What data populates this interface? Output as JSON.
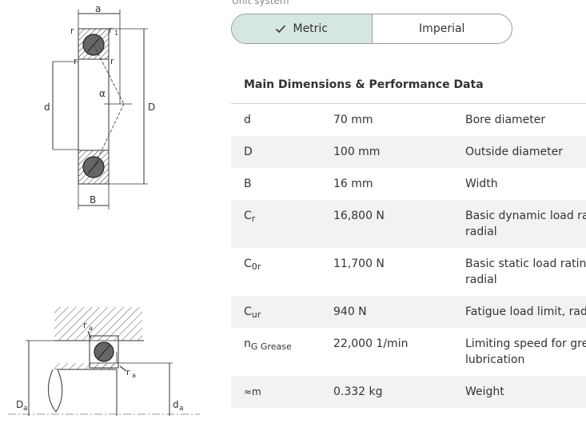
{
  "unit_system": {
    "label": "Unit system",
    "options": [
      {
        "label": "Metric",
        "selected": true
      },
      {
        "label": "Imperial",
        "selected": false
      }
    ]
  },
  "section": {
    "title": "Main Dimensions & Performance Data"
  },
  "drawing_top": {
    "labels": {
      "a": "a",
      "r": "r",
      "r1": "r",
      "r1_sub": "1",
      "alpha": "α",
      "d": "d",
      "D": "D",
      "B": "B"
    }
  },
  "drawing_bottom": {
    "labels": {
      "ra": "r",
      "ra_sub": "a",
      "Da": "D",
      "Da_sub": "a",
      "da": "d",
      "da_sub": "a"
    }
  },
  "rows": [
    {
      "symbol": "d",
      "sub": "",
      "value": "70 mm",
      "desc_line1": "Bore diameter",
      "desc_line2": ""
    },
    {
      "symbol": "D",
      "sub": "",
      "value": "100 mm",
      "desc_line1": "Outside diameter",
      "desc_line2": ""
    },
    {
      "symbol": "B",
      "sub": "",
      "value": "16 mm",
      "desc_line1": "Width",
      "desc_line2": ""
    },
    {
      "symbol": "C",
      "sub": "r",
      "value": "16,800 N",
      "desc_line1": "Basic dynamic load rat",
      "desc_line2": "radial"
    },
    {
      "symbol": "C",
      "sub": "0r",
      "value": "11,700 N",
      "desc_line1": "Basic static load rating",
      "desc_line2": "radial"
    },
    {
      "symbol": "C",
      "sub": "ur",
      "value": "940 N",
      "desc_line1": "Fatigue load limit, radi",
      "desc_line2": ""
    },
    {
      "symbol": "n",
      "sub": "G Grease",
      "value": "22,000 1/min",
      "desc_line1": "Limiting speed for gre",
      "desc_line2": "lubrication"
    },
    {
      "symbol": "≈m",
      "sub": "",
      "value": "0.332 kg",
      "desc_line1": "Weight",
      "desc_line2": ""
    }
  ],
  "colors": {
    "selected_bg": "#d6e6e0",
    "row_shade": "#f2f2f2",
    "text": "#333333"
  }
}
